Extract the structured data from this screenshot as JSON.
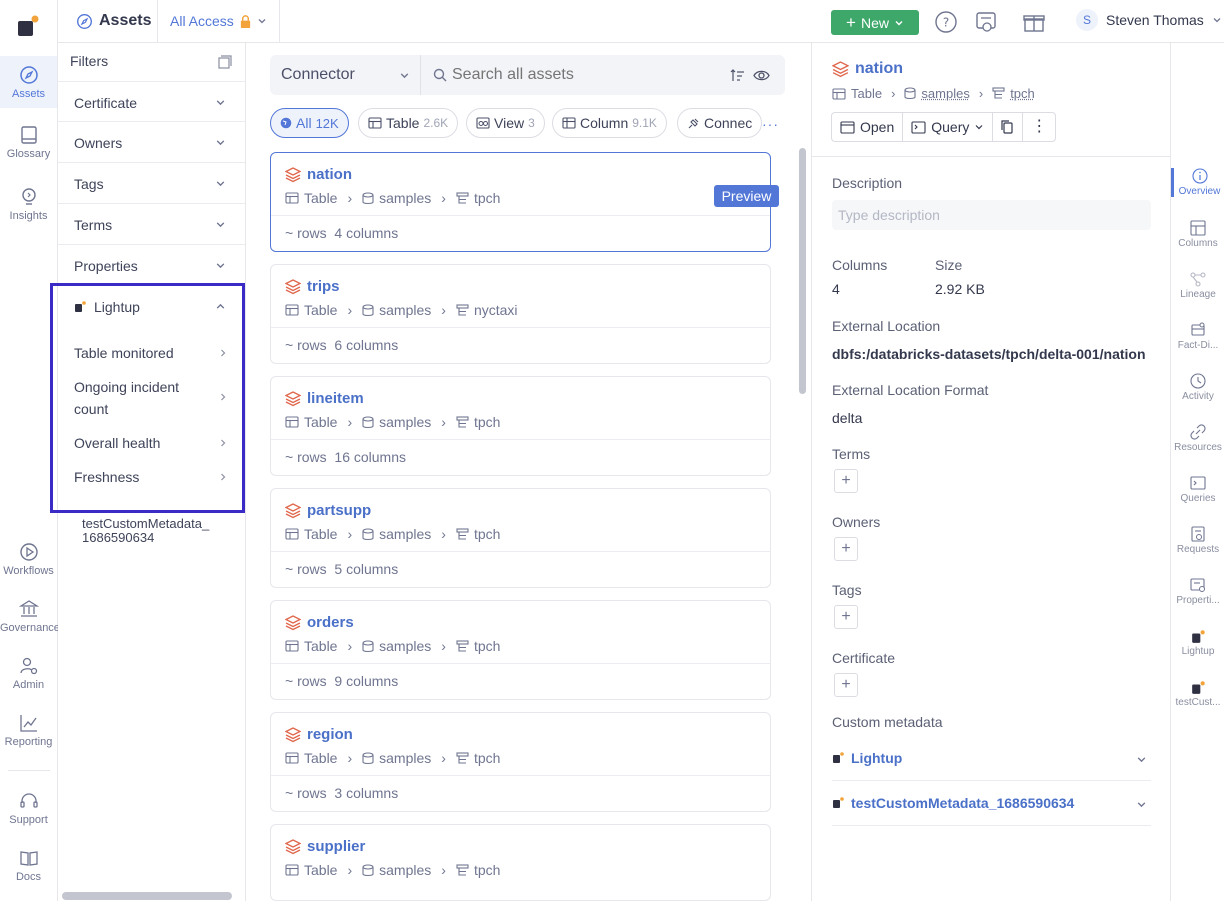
{
  "rail": {
    "items": [
      {
        "label": "Assets",
        "icon": "compass-icon"
      },
      {
        "label": "Glossary",
        "icon": "book-icon"
      },
      {
        "label": "Insights",
        "icon": "bulb-icon"
      },
      {
        "label": "Workflows",
        "icon": "play-icon"
      },
      {
        "label": "Governance",
        "icon": "bank-icon"
      },
      {
        "label": "Admin",
        "icon": "user-gear-icon"
      },
      {
        "label": "Reporting",
        "icon": "chart-icon"
      },
      {
        "label": "Support",
        "icon": "headset-icon"
      },
      {
        "label": "Docs",
        "icon": "open-book-icon"
      }
    ]
  },
  "topbar": {
    "title": "Assets",
    "access": "All Access",
    "new_label": "New",
    "user_initial": "S",
    "user_name": "Steven Thomas"
  },
  "filters": {
    "heading": "Filters",
    "rows": [
      "Certificate",
      "Owners",
      "Tags",
      "Terms",
      "Properties"
    ],
    "lightup": {
      "label": "Lightup",
      "items": [
        "Table monitored",
        "Ongoing incident count",
        "Overall health",
        "Freshness"
      ]
    },
    "custom_meta": "testCustomMetadata_\n1686590634"
  },
  "search": {
    "connector_label": "Connector",
    "placeholder": "Search all assets"
  },
  "chips": [
    {
      "label": "All",
      "count": "12K"
    },
    {
      "label": "Table",
      "count": "2.6K"
    },
    {
      "label": "View",
      "count": "3"
    },
    {
      "label": "Column",
      "count": "9.1K"
    },
    {
      "label": "Connec",
      "count": ""
    }
  ],
  "assets": [
    {
      "name": "nation",
      "type": "Table",
      "db": "samples",
      "schema": "tpch",
      "rows": "~ rows",
      "columns": "4 columns"
    },
    {
      "name": "trips",
      "type": "Table",
      "db": "samples",
      "schema": "nyctaxi",
      "rows": "~ rows",
      "columns": "6 columns"
    },
    {
      "name": "lineitem",
      "type": "Table",
      "db": "samples",
      "schema": "tpch",
      "rows": "~ rows",
      "columns": "16 columns"
    },
    {
      "name": "partsupp",
      "type": "Table",
      "db": "samples",
      "schema": "tpch",
      "rows": "~ rows",
      "columns": "5 columns"
    },
    {
      "name": "orders",
      "type": "Table",
      "db": "samples",
      "schema": "tpch",
      "rows": "~ rows",
      "columns": "9 columns"
    },
    {
      "name": "region",
      "type": "Table",
      "db": "samples",
      "schema": "tpch",
      "rows": "~ rows",
      "columns": "3 columns"
    },
    {
      "name": "supplier",
      "type": "Table",
      "db": "samples",
      "schema": "tpch",
      "rows": "",
      "columns": ""
    }
  ],
  "preview_label": "Preview",
  "detail": {
    "title": "nation",
    "type": "Table",
    "db": "samples",
    "schema": "tpch",
    "open_label": "Open",
    "query_label": "Query",
    "description_label": "Description",
    "description_placeholder": "Type description",
    "columns_label": "Columns",
    "columns_value": "4",
    "size_label": "Size",
    "size_value": "2.92 KB",
    "ext_loc_label": "External Location",
    "ext_loc_value": "dbfs:/databricks-datasets/tpch/delta-001/nation",
    "ext_fmt_label": "External Location Format",
    "ext_fmt_value": "delta",
    "terms_label": "Terms",
    "owners_label": "Owners",
    "tags_label": "Tags",
    "certificate_label": "Certificate",
    "custom_metadata_label": "Custom metadata",
    "custom_metadata": [
      "Lightup",
      "testCustomMetadata_1686590634"
    ]
  },
  "right_tabs": [
    "Overview",
    "Columns",
    "Lineage",
    "Fact-Di...",
    "Activity",
    "Resources",
    "Queries",
    "Requests",
    "Properti...",
    "Lightup",
    "testCust..."
  ],
  "colors": {
    "accent": "#5277d7",
    "new_button": "#3ea86b",
    "highlight": "#3a2bc7",
    "table_icon": "#e0674c"
  }
}
